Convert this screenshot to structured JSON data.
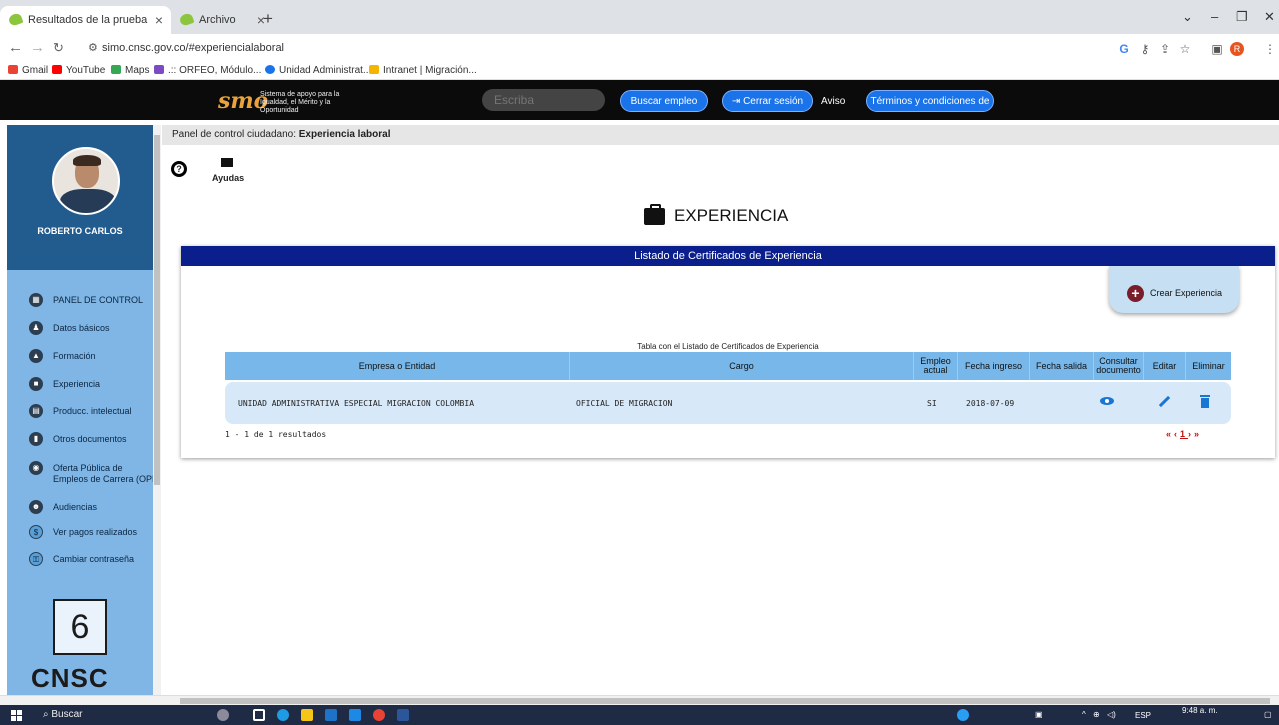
{
  "browser": {
    "tabs": [
      {
        "title": "Resultados de la prueba",
        "active": true
      },
      {
        "title": "Archivo PDF",
        "active": false
      }
    ],
    "url": "simo.cnsc.gov.co/#experiencialaboral",
    "bookmarks": [
      "Gmail",
      "YouTube",
      "Maps",
      ".:: ORFEO, Módulo...",
      "Unidad Administrat...",
      "Intranet | Migración..."
    ]
  },
  "header": {
    "logo_text": "smo",
    "tagline": "Sistema de apoyo para la Igualdad, el Mérito y la Oportunidad",
    "search_placeholder": "Escriba",
    "buscar": "Buscar empleo",
    "cerrar": "Cerrar sesión",
    "aviso": "Aviso",
    "terminos": "Términos y condiciones de uso"
  },
  "sidebar": {
    "user_name": "ROBERTO CARLOS",
    "items": [
      {
        "label": "PANEL DE CONTROL",
        "icon": "dashboard-icon"
      },
      {
        "label": "Datos básicos",
        "icon": "people-icon"
      },
      {
        "label": "Formación",
        "icon": "graduation-icon"
      },
      {
        "label": "Experiencia",
        "icon": "briefcase-icon"
      },
      {
        "label": "Producc. intelectual",
        "icon": "library-icon"
      },
      {
        "label": "Otros documentos",
        "icon": "document-icon"
      },
      {
        "label": "Oferta Pública de",
        "label2": "Empleos de Carrera (OPEC)",
        "icon": "globe-icon"
      },
      {
        "label": "Audiencias",
        "icon": "audience-icon"
      },
      {
        "label": "Ver pagos realizados",
        "icon": "dollar-icon"
      },
      {
        "label": "Cambiar contraseña",
        "icon": "lock-icon"
      }
    ],
    "org": "CNSC"
  },
  "main": {
    "breadcrumb_prefix": "Panel de control ciudadano: ",
    "breadcrumb_current": "Experiencia laboral",
    "ayudas": "Ayudas",
    "section_title": "EXPERIENCIA",
    "panel_title": "Listado de Certificados de Experiencia",
    "create_label": "Crear Experiencia",
    "table_caption": "Tabla con el Listado de Certificados de Experiencia",
    "columns": [
      "Empresa o Entidad",
      "Cargo",
      "Empleo actual",
      "Fecha ingreso",
      "Fecha salida",
      "Consultar documento",
      "Editar",
      "Eliminar"
    ],
    "rows": [
      {
        "empresa": "UNIDAD ADMINISTRATIVA ESPECIAL MIGRACION COLOMBIA",
        "cargo": "OFICIAL DE MIGRACION",
        "actual": "SI",
        "ingreso": "2018-07-09",
        "salida": ""
      }
    ],
    "results": "1 - 1 de 1 resultados",
    "pager": [
      "«",
      "‹",
      "1",
      "›",
      "»"
    ]
  },
  "taskbar": {
    "search": "Buscar",
    "lang": "ESP",
    "time": "9:48 a. m."
  }
}
